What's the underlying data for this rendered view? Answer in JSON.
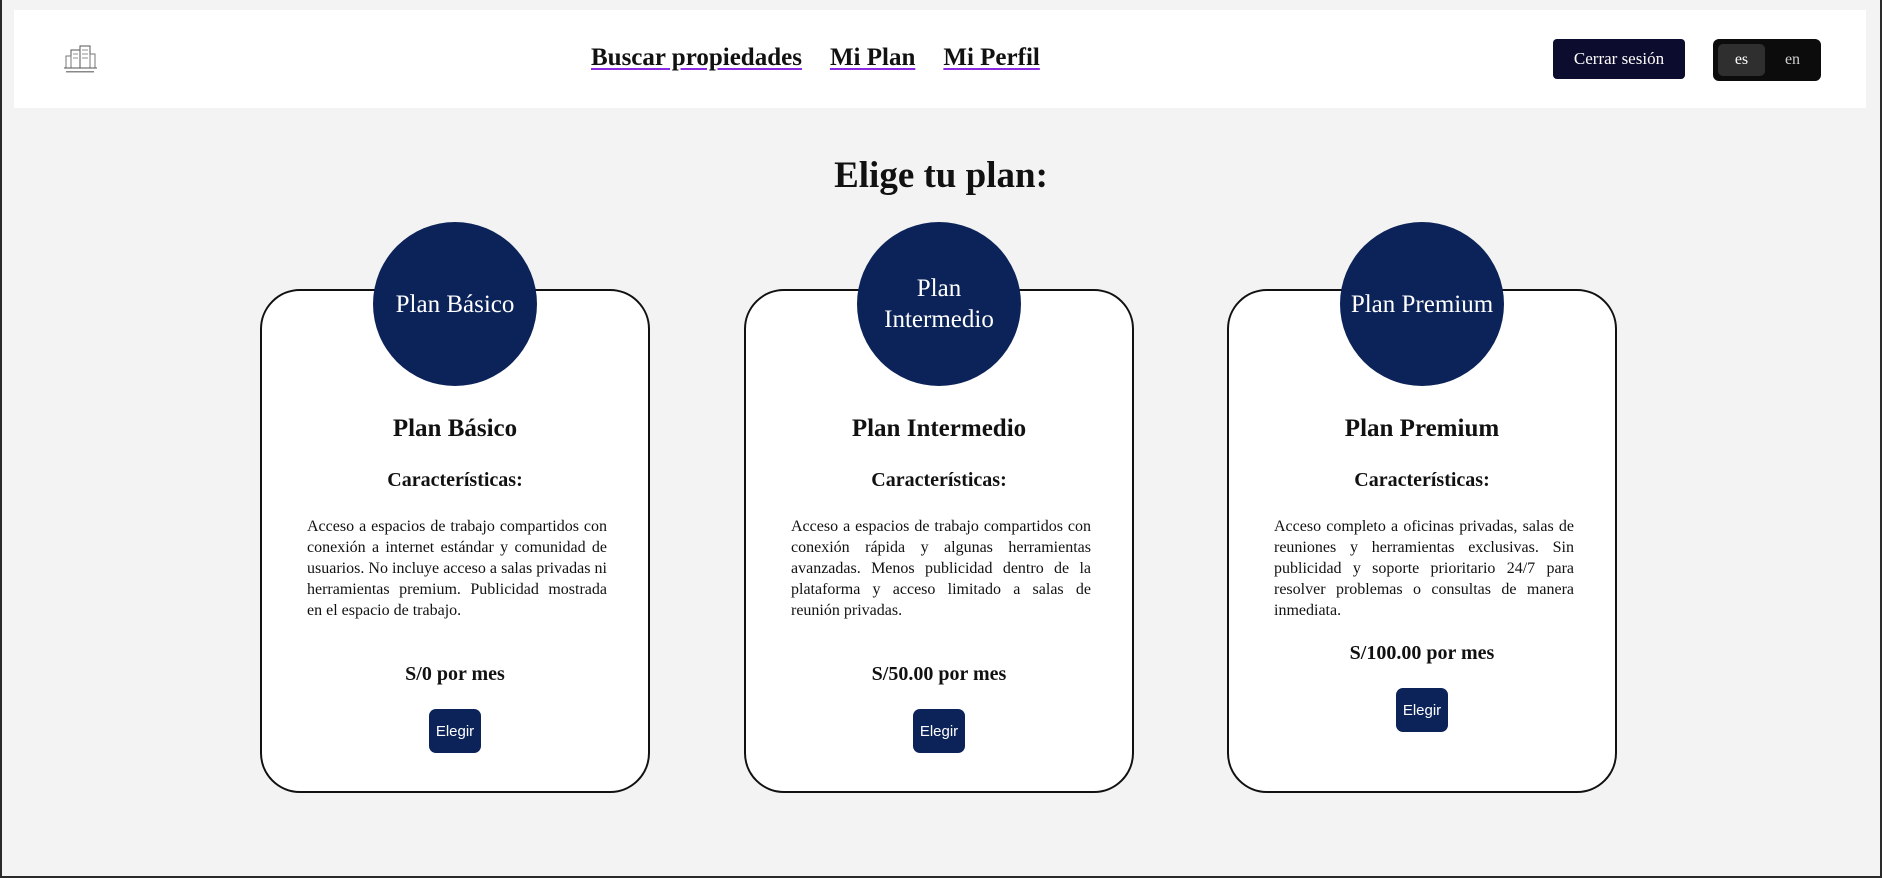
{
  "header": {
    "nav": [
      {
        "label": "Buscar propiedades"
      },
      {
        "label": "Mi Plan"
      },
      {
        "label": "Mi Perfil"
      }
    ],
    "logout_label": "Cerrar sesión",
    "languages": [
      {
        "code": "es",
        "active": true
      },
      {
        "code": "en",
        "active": false
      }
    ]
  },
  "main": {
    "title": "Elige tu plan:",
    "plans": [
      {
        "badge": "Plan Básico",
        "name": "Plan Básico",
        "features_title": "Características:",
        "description": "Acceso a espacios de trabajo compartidos con conexión a internet estándar y comunidad de usuarios. No incluye acceso a salas privadas ni herramientas premium. Publicidad mostrada en el espacio de trabajo.",
        "price": "S/0 por mes",
        "button": "Elegir"
      },
      {
        "badge": "Plan Intermedio",
        "name": "Plan Intermedio",
        "features_title": "Características:",
        "description": "Acceso a espacios de trabajo compartidos con conexión rápida y algunas herramientas avanzadas. Menos publicidad dentro de la plataforma y acceso limitado a salas de reunión privadas.",
        "price": "S/50.00 por mes",
        "button": "Elegir"
      },
      {
        "badge": "Plan Premium",
        "name": "Plan Premium",
        "features_title": "Características:",
        "description": "Acceso completo a oficinas privadas, salas de reuniones y herramientas exclusivas. Sin publicidad y soporte prioritario 24/7 para resolver problemas o consultas de manera inmediata.",
        "price": "S/100.00 por mes",
        "button": "Elegir"
      }
    ]
  },
  "colors": {
    "badge": "#0b2358",
    "logout_button": "#0c0c2e",
    "lang_switch": "#0c0c0c",
    "background": "#f3f3f3",
    "nav_underline": "#8a2be2"
  },
  "icons": {
    "logo": "building-logo-icon"
  }
}
